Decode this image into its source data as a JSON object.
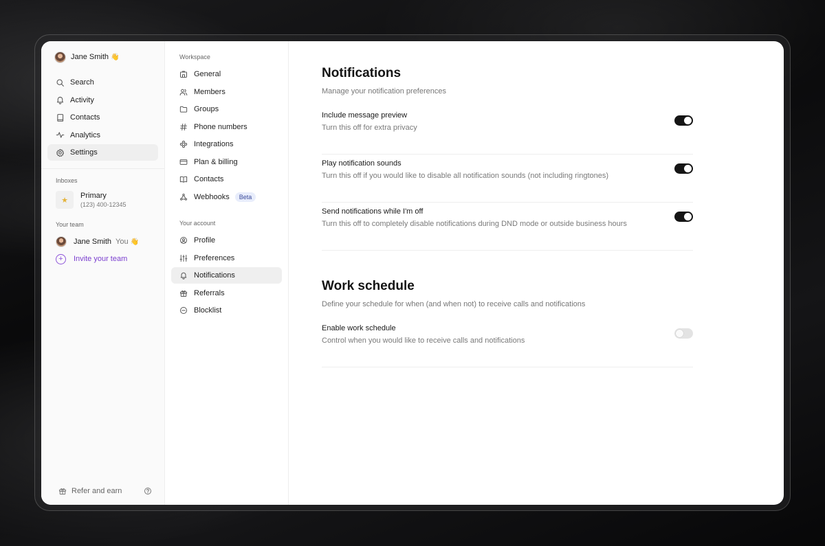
{
  "user": {
    "name": "Jane Smith",
    "emoji": "👋"
  },
  "sidebar": {
    "items": [
      {
        "label": "Search",
        "icon": "search-icon"
      },
      {
        "label": "Activity",
        "icon": "bell-icon"
      },
      {
        "label": "Contacts",
        "icon": "book-icon"
      },
      {
        "label": "Analytics",
        "icon": "pulse-icon"
      },
      {
        "label": "Settings",
        "icon": "gear-icon",
        "active": true
      }
    ],
    "inboxes_label": "Inboxes",
    "inbox": {
      "name": "Primary",
      "phone": "(123) 400-12345",
      "icon": "star-icon"
    },
    "team_label": "Your team",
    "team_member": {
      "name": "Jane Smith",
      "tag": "You",
      "emoji": "👋"
    },
    "invite_label": "Invite your team",
    "footer": {
      "refer_label": "Refer and earn",
      "help_icon": "help-icon"
    }
  },
  "settings_menu": {
    "workspace_label": "Workspace",
    "workspace_items": [
      {
        "label": "General",
        "icon": "building-icon"
      },
      {
        "label": "Members",
        "icon": "users-icon"
      },
      {
        "label": "Groups",
        "icon": "folder-icon"
      },
      {
        "label": "Phone numbers",
        "icon": "hash-icon"
      },
      {
        "label": "Integrations",
        "icon": "puzzle-icon"
      },
      {
        "label": "Plan & billing",
        "icon": "card-icon"
      },
      {
        "label": "Contacts",
        "icon": "book-open-icon"
      },
      {
        "label": "Webhooks",
        "icon": "webhook-icon",
        "badge": "Beta"
      }
    ],
    "account_label": "Your account",
    "account_items": [
      {
        "label": "Profile",
        "icon": "user-circle-icon"
      },
      {
        "label": "Preferences",
        "icon": "sliders-icon"
      },
      {
        "label": "Notifications",
        "icon": "bell-icon",
        "active": true
      },
      {
        "label": "Referrals",
        "icon": "gift-icon"
      },
      {
        "label": "Blocklist",
        "icon": "block-icon"
      }
    ]
  },
  "notifications": {
    "title": "Notifications",
    "description": "Manage your notification preferences",
    "settings": [
      {
        "title": "Include message preview",
        "description": "Turn this off for extra privacy",
        "enabled": true
      },
      {
        "title": "Play notification sounds",
        "description": "Turn this off if you would like to disable all notification sounds (not including ringtones)",
        "enabled": true
      },
      {
        "title": "Send notifications while I'm off",
        "description": "Turn this off to completely disable notifications during DND mode or outside business hours",
        "enabled": true
      }
    ]
  },
  "work_schedule": {
    "title": "Work schedule",
    "description": "Define your schedule for when (and when not) to receive calls and notifications",
    "settings": [
      {
        "title": "Enable work schedule",
        "description": "Control when you would like to receive calls and notifications",
        "enabled": false
      }
    ]
  },
  "colors": {
    "accent": "#7a3ecf",
    "toggle_on": "#151515",
    "toggle_off": "#e3e3e3",
    "active_bg": "#efefef"
  }
}
